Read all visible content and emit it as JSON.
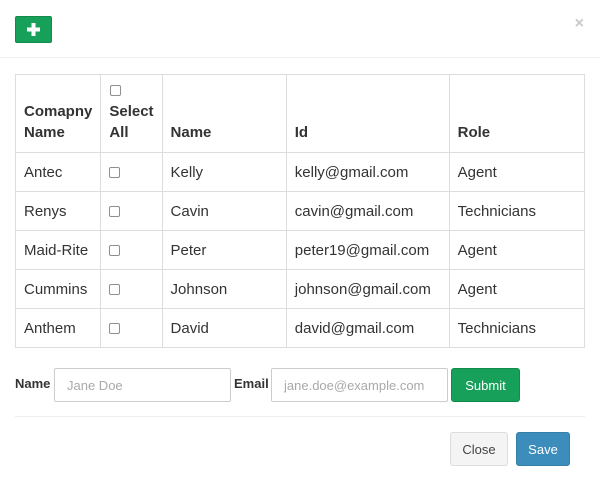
{
  "header": {
    "add_icon": "plus-icon",
    "close_glyph": "×"
  },
  "table": {
    "headers": {
      "company": "Comapny Name",
      "select_all": "Select All",
      "name": "Name",
      "id": "Id",
      "role": "Role"
    },
    "rows": [
      {
        "company": "Antec",
        "name": "Kelly",
        "id": "kelly@gmail.com",
        "role": "Agent",
        "checked": false
      },
      {
        "company": "Renys",
        "name": "Cavin",
        "id": "cavin@gmail.com",
        "role": "Technicians",
        "checked": false
      },
      {
        "company": "Maid-Rite",
        "name": "Peter",
        "id": "peter19@gmail.com",
        "role": "Agent",
        "checked": false
      },
      {
        "company": "Cummins",
        "name": "Johnson",
        "id": "johnson@gmail.com",
        "role": "Agent",
        "checked": false
      },
      {
        "company": "Anthem",
        "name": "David",
        "id": "david@gmail.com",
        "role": "Technicians",
        "checked": false
      }
    ]
  },
  "form": {
    "name_label": "Name",
    "name_value": "",
    "name_placeholder": "Jane Doe",
    "email_label": "Email",
    "email_value": "",
    "email_placeholder": "jane.doe@example.com",
    "submit_label": "Submit"
  },
  "footer": {
    "close_label": "Close",
    "save_label": "Save"
  },
  "colors": {
    "green": "#16a05a",
    "blue": "#3c8dbc",
    "border": "#dddddd"
  }
}
